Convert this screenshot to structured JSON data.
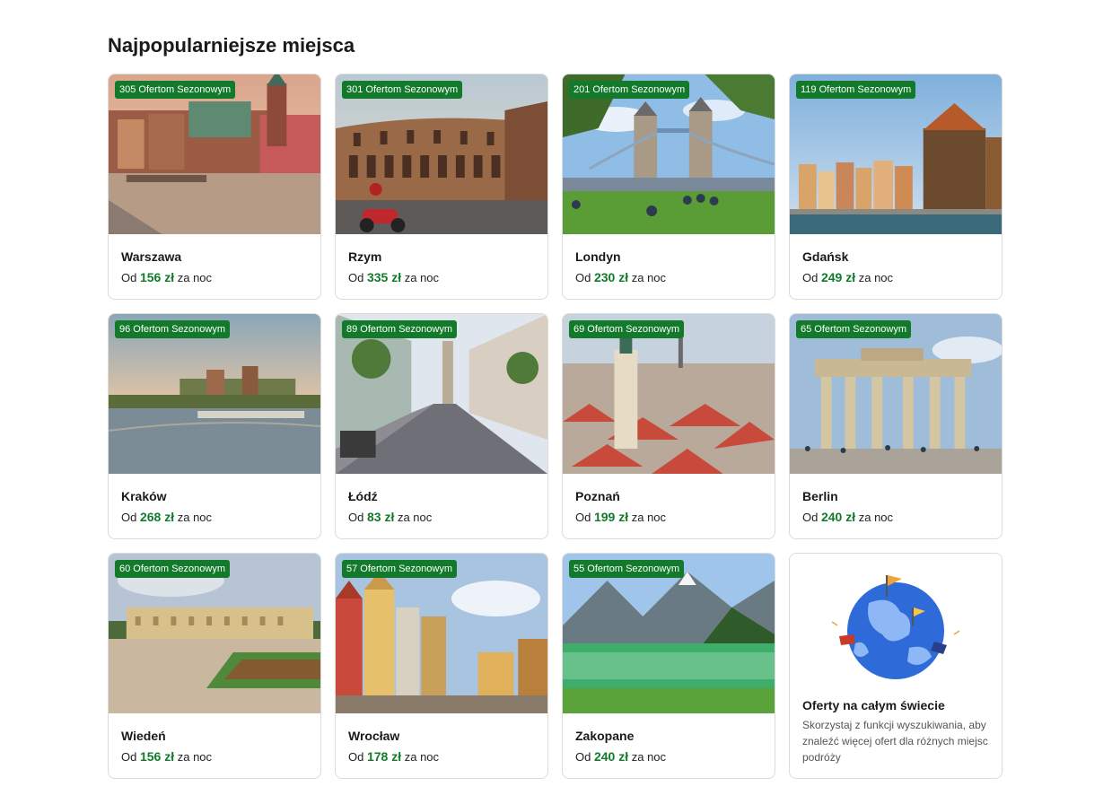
{
  "section": {
    "title": "Najpopularniejsze miejsca"
  },
  "price_prefix": "Od",
  "currency": "zł",
  "price_suffix": "za noc",
  "colors": {
    "accent_green": "#137a2c",
    "card_border": "#dcdcdc"
  },
  "destinations": [
    {
      "city": "Warszawa",
      "offers": "305 Ofertom Sezonowym",
      "price": "156",
      "image": "warsaw-old-town"
    },
    {
      "city": "Rzym",
      "offers": "301 Ofertom Sezonowym",
      "price": "335",
      "image": "rome-colosseum"
    },
    {
      "city": "Londyn",
      "offers": "201 Ofertom Sezonowym",
      "price": "230",
      "image": "london-tower-bridge"
    },
    {
      "city": "Gdańsk",
      "offers": "119 Ofertom Sezonowym",
      "price": "249",
      "image": "gdansk-crane"
    },
    {
      "city": "Kraków",
      "offers": "96 Ofertom Sezonowym",
      "price": "268",
      "image": "krakow-wawel-river"
    },
    {
      "city": "Łódź",
      "offers": "89 Ofertom Sezonowym",
      "price": "83",
      "image": "lodz-piotrkowska-street"
    },
    {
      "city": "Poznań",
      "offers": "69 Ofertom Sezonowym",
      "price": "199",
      "image": "poznan-rooftops"
    },
    {
      "city": "Berlin",
      "offers": "65 Ofertom Sezonowym",
      "price": "240",
      "image": "berlin-brandenburg-gate"
    },
    {
      "city": "Wiedeń",
      "offers": "60 Ofertom Sezonowym",
      "price": "156",
      "image": "vienna-schonbrunn"
    },
    {
      "city": "Wrocław",
      "offers": "57 Ofertom Sezonowym",
      "price": "178",
      "image": "wroclaw-market-square"
    },
    {
      "city": "Zakopane",
      "offers": "55 Ofertom Sezonowym",
      "price": "240",
      "image": "zakopane-mountain-lake"
    }
  ],
  "promo": {
    "title": "Oferty na całym świecie",
    "text": "Skorzystaj z funkcji wyszukiwania, aby znaleźć więcej ofert dla różnych miejsc podróży",
    "icon": "globe-flags-icon"
  }
}
